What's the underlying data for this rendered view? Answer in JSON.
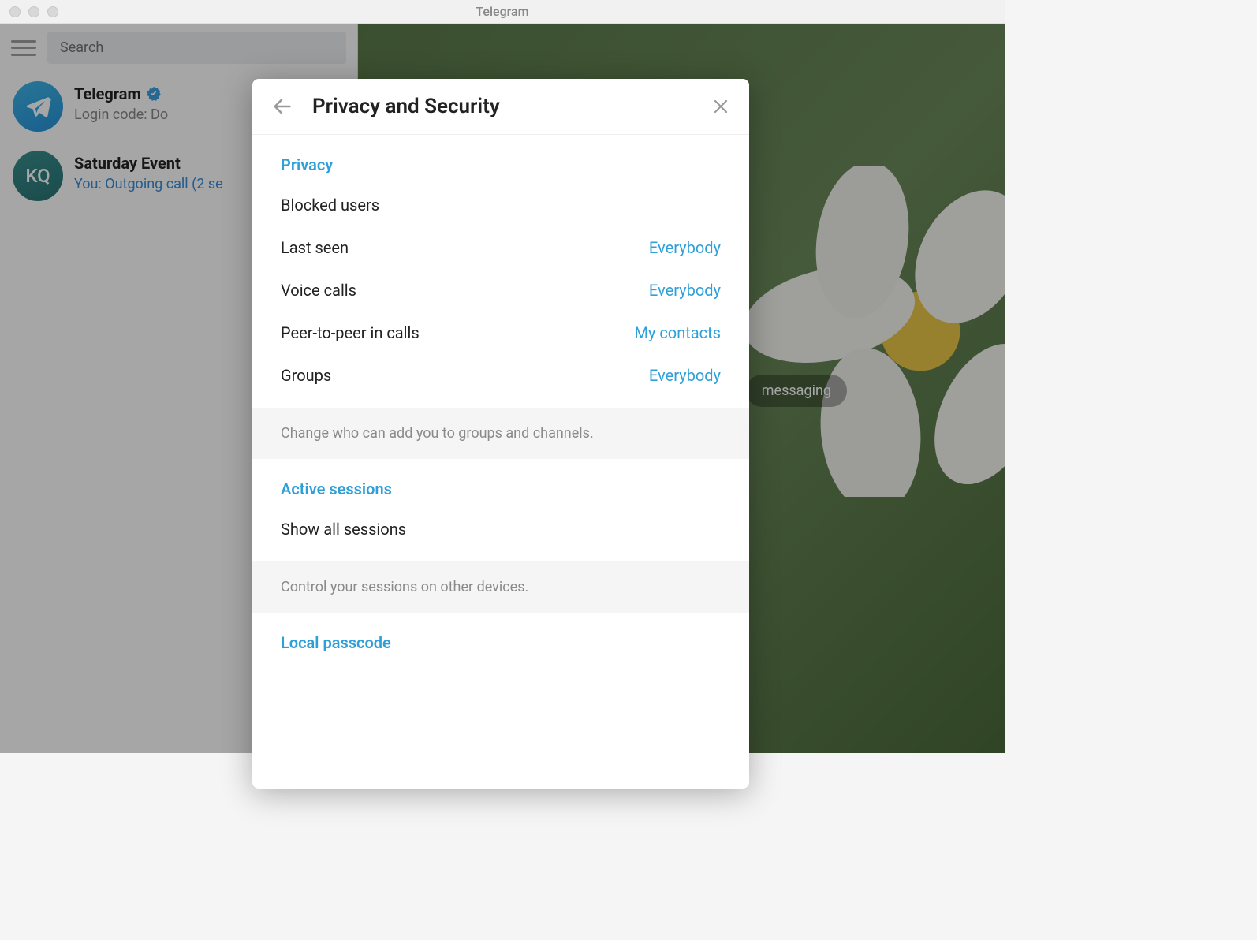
{
  "window": {
    "title": "Telegram"
  },
  "sidebar": {
    "search_placeholder": "Search",
    "chats": [
      {
        "avatar_type": "telegram",
        "title": "Telegram",
        "preview": "Login code:          Do",
        "preview_color": "gray",
        "verified": true
      },
      {
        "avatar_type": "initials",
        "avatar_text": "KQ",
        "title": "Saturday Event",
        "preview": "You: Outgoing call (2 se",
        "preview_color": "blue",
        "verified": false
      }
    ]
  },
  "main": {
    "badge_text": "messaging"
  },
  "modal": {
    "title": "Privacy and Security",
    "sections": [
      {
        "heading": "Privacy",
        "rows": [
          {
            "label": "Blocked users",
            "value": ""
          },
          {
            "label": "Last seen",
            "value": "Everybody"
          },
          {
            "label": "Voice calls",
            "value": "Everybody"
          },
          {
            "label": "Peer-to-peer in calls",
            "value": "My contacts"
          },
          {
            "label": "Groups",
            "value": "Everybody"
          }
        ],
        "footer": "Change who can add you to groups and channels."
      },
      {
        "heading": "Active sessions",
        "rows": [
          {
            "label": "Show all sessions",
            "value": ""
          }
        ],
        "footer": "Control your sessions on other devices."
      },
      {
        "heading": "Local passcode",
        "rows": [],
        "footer": ""
      }
    ]
  }
}
